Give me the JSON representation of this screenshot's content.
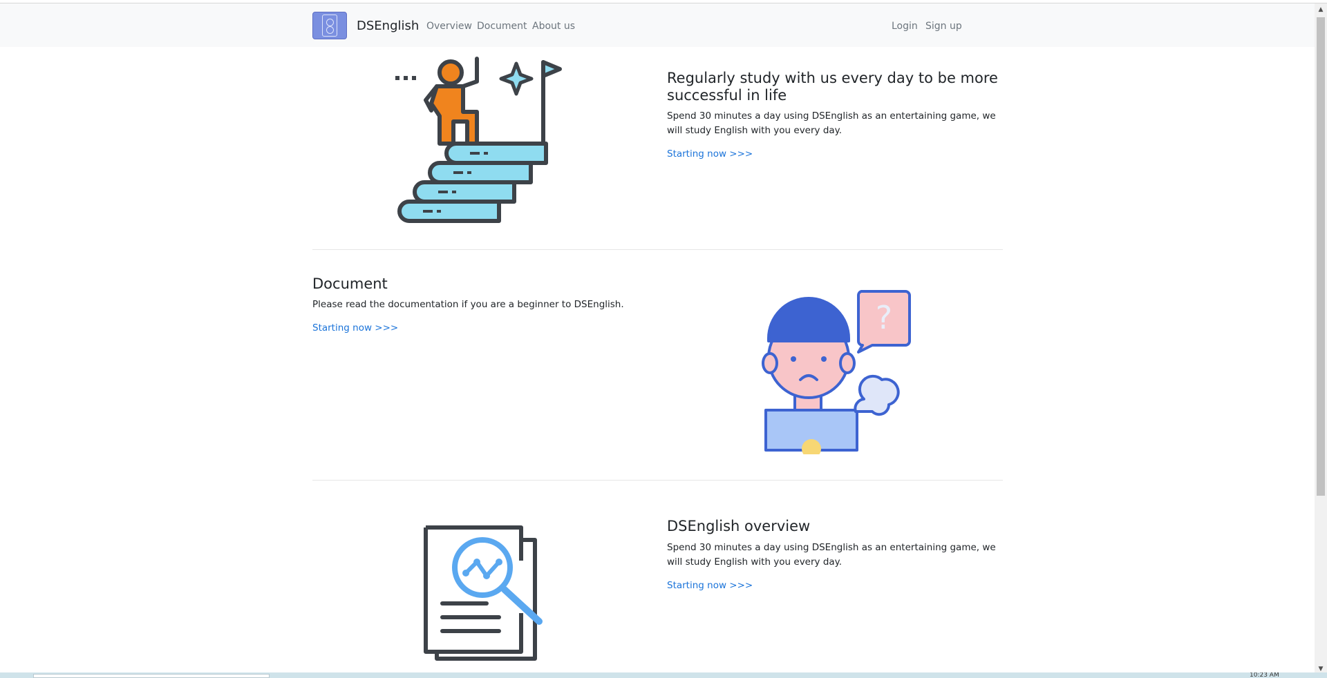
{
  "navbar": {
    "brand": "DSEnglish",
    "links": [
      "Overview",
      "Document",
      "About us"
    ],
    "login": "Login",
    "signup": "Sign up"
  },
  "sections": [
    {
      "title": "Regularly study with us every day to be more successful in life",
      "text": "Spend 30 minutes a day using DSEnglish as an entertaining game, we will study English with you every day.",
      "link": "Starting now >>>",
      "illustration": "stairs-books-icon"
    },
    {
      "title": "Document",
      "text": "Please read the documentation if you are a beginner to DSEnglish.",
      "link": "Starting now >>>",
      "illustration": "confused-person-icon"
    },
    {
      "title": "DSEnglish overview",
      "text": "Spend 30 minutes a day using DSEnglish as an entertaining game, we will study English with you every day.",
      "link": "Starting now >>>",
      "illustration": "document-analytics-icon"
    }
  ],
  "taskbar": {
    "clock": "10:23 AM"
  },
  "colors": {
    "link": "#1a73d9",
    "navbar_bg": "#f8f9fa",
    "orange": "#f0841e",
    "light_blue": "#8fdcf0",
    "dark": "#3d4248",
    "person_blue": "#3d63d1",
    "pink": "#f8c5c8"
  }
}
